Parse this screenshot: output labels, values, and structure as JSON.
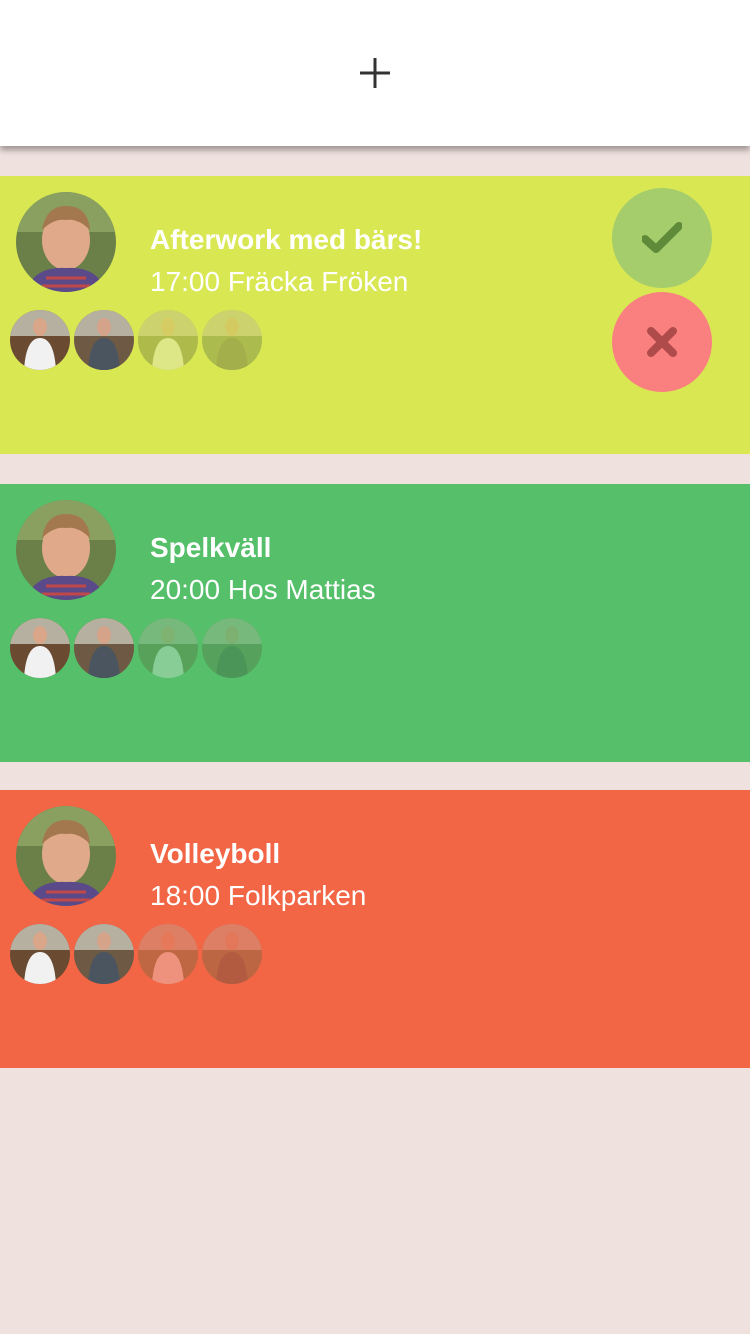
{
  "header": {
    "add_icon": "plus-icon"
  },
  "colors": {
    "background": "#efe1de",
    "accept_bg": "#a6cd6c",
    "accept_icon": "#5f8a3a",
    "decline_bg": "#fa8080",
    "decline_icon": "#b04b4b"
  },
  "events": [
    {
      "title": "Afterwork med bärs!",
      "subtitle": "17:00 Fräcka Fröken",
      "color": "#d9e753",
      "pending": true,
      "participants": [
        {
          "name": "participant-1",
          "confirmed": true
        },
        {
          "name": "participant-2",
          "confirmed": true
        },
        {
          "name": "participant-3",
          "confirmed": false
        },
        {
          "name": "participant-4",
          "confirmed": false
        }
      ]
    },
    {
      "title": "Spelkväll",
      "subtitle": "20:00 Hos Mattias",
      "color": "#55bf6a",
      "pending": false,
      "participants": [
        {
          "name": "participant-1",
          "confirmed": true
        },
        {
          "name": "participant-2",
          "confirmed": true
        },
        {
          "name": "participant-3",
          "confirmed": false
        },
        {
          "name": "participant-4",
          "confirmed": false
        }
      ]
    },
    {
      "title": "Volleyboll",
      "subtitle": "18:00 Folkparken",
      "color": "#f26545",
      "pending": false,
      "participants": [
        {
          "name": "participant-1",
          "confirmed": true
        },
        {
          "name": "participant-2",
          "confirmed": true
        },
        {
          "name": "participant-3",
          "confirmed": false
        },
        {
          "name": "participant-4",
          "confirmed": false
        }
      ]
    }
  ],
  "actions": {
    "accept_icon": "check-icon",
    "decline_icon": "close-icon"
  }
}
